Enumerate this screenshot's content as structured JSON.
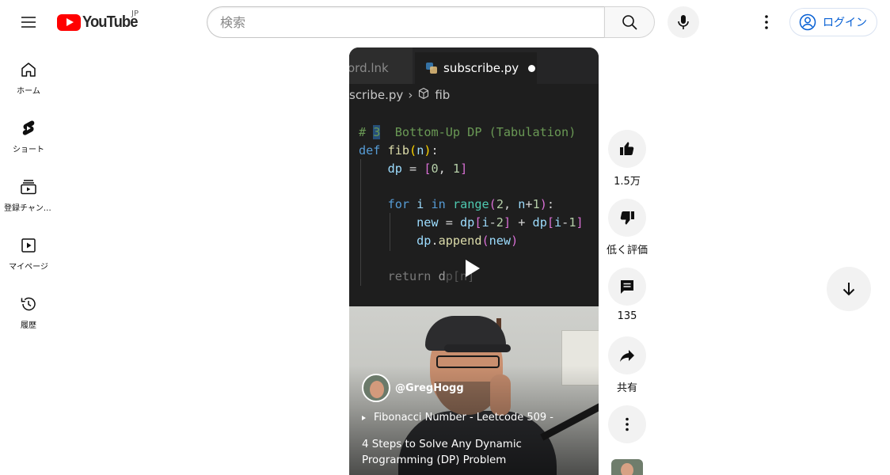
{
  "header": {
    "logo_text": "YouTube",
    "logo_region": "JP",
    "search_placeholder": "検索",
    "signin_label": "ログイン"
  },
  "sidebar": {
    "items": [
      {
        "label": "ホーム",
        "icon": "home-icon"
      },
      {
        "label": "ショート",
        "icon": "shorts-icon"
      },
      {
        "label": "登録チャンネル",
        "icon": "subscriptions-icon"
      },
      {
        "label": "マイページ",
        "icon": "you-icon"
      },
      {
        "label": "履歴",
        "icon": "history-icon"
      }
    ]
  },
  "video": {
    "editor": {
      "prev_tab": "ord.lnk",
      "active_tab": "subscribe.py",
      "breadcrumb_file": "scribe.py",
      "breadcrumb_symbol": "fib"
    },
    "channel": "@GregHogg",
    "related": "Fibonacci Number - Leetcode 509 -",
    "title": "4 Steps to Solve Any Dynamic Programming (DP) Problem"
  },
  "actions": {
    "like_count": "1.5万",
    "dislike_label": "低く評価",
    "comment_count": "135",
    "share_label": "共有"
  },
  "colors": {
    "brand_red": "#ff0000",
    "link_blue": "#065fd4",
    "chip_gray": "#f2f2f2"
  }
}
